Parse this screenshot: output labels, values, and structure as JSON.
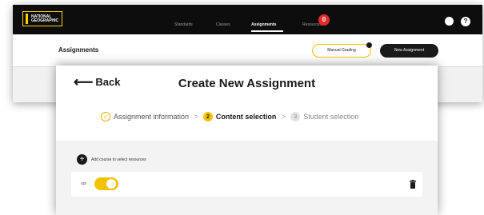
{
  "topbar": {
    "logo_text": "NATIONAL GEOGRAPHIC",
    "nav_items": [
      "Standards",
      "Classes",
      "Assignments",
      "Resources"
    ],
    "active_nav": "Assignments",
    "notification_count": "0",
    "help_label": "?"
  },
  "subbar": {
    "page_heading": "Assignments",
    "manual_grading_label": "Manual Grading",
    "new_assignment_label": "New Assignment"
  },
  "modal": {
    "back_label": "Back",
    "title": "Create New Assignment",
    "steps": [
      {
        "number": "✓",
        "label": "Assignment information",
        "state": "done"
      },
      {
        "number": "2",
        "label": "Content selection",
        "state": "current"
      },
      {
        "number": "3",
        "label": "Student selection",
        "state": "todo"
      }
    ],
    "step_separator": ">",
    "add_course_label": "Add course to select resources",
    "add_icon": "+",
    "course_row": {
      "toggle_label": "opt",
      "toggle_on": true
    }
  },
  "colors": {
    "accent_yellow": "#f2c200",
    "topbar_bg": "#0d0d0d",
    "notification_red": "#e32b2b"
  },
  "icons": [
    "logo-icon",
    "bell-icon",
    "user-icon",
    "help-icon",
    "back-arrow-icon",
    "check-icon",
    "plus-icon",
    "trash-icon"
  ]
}
